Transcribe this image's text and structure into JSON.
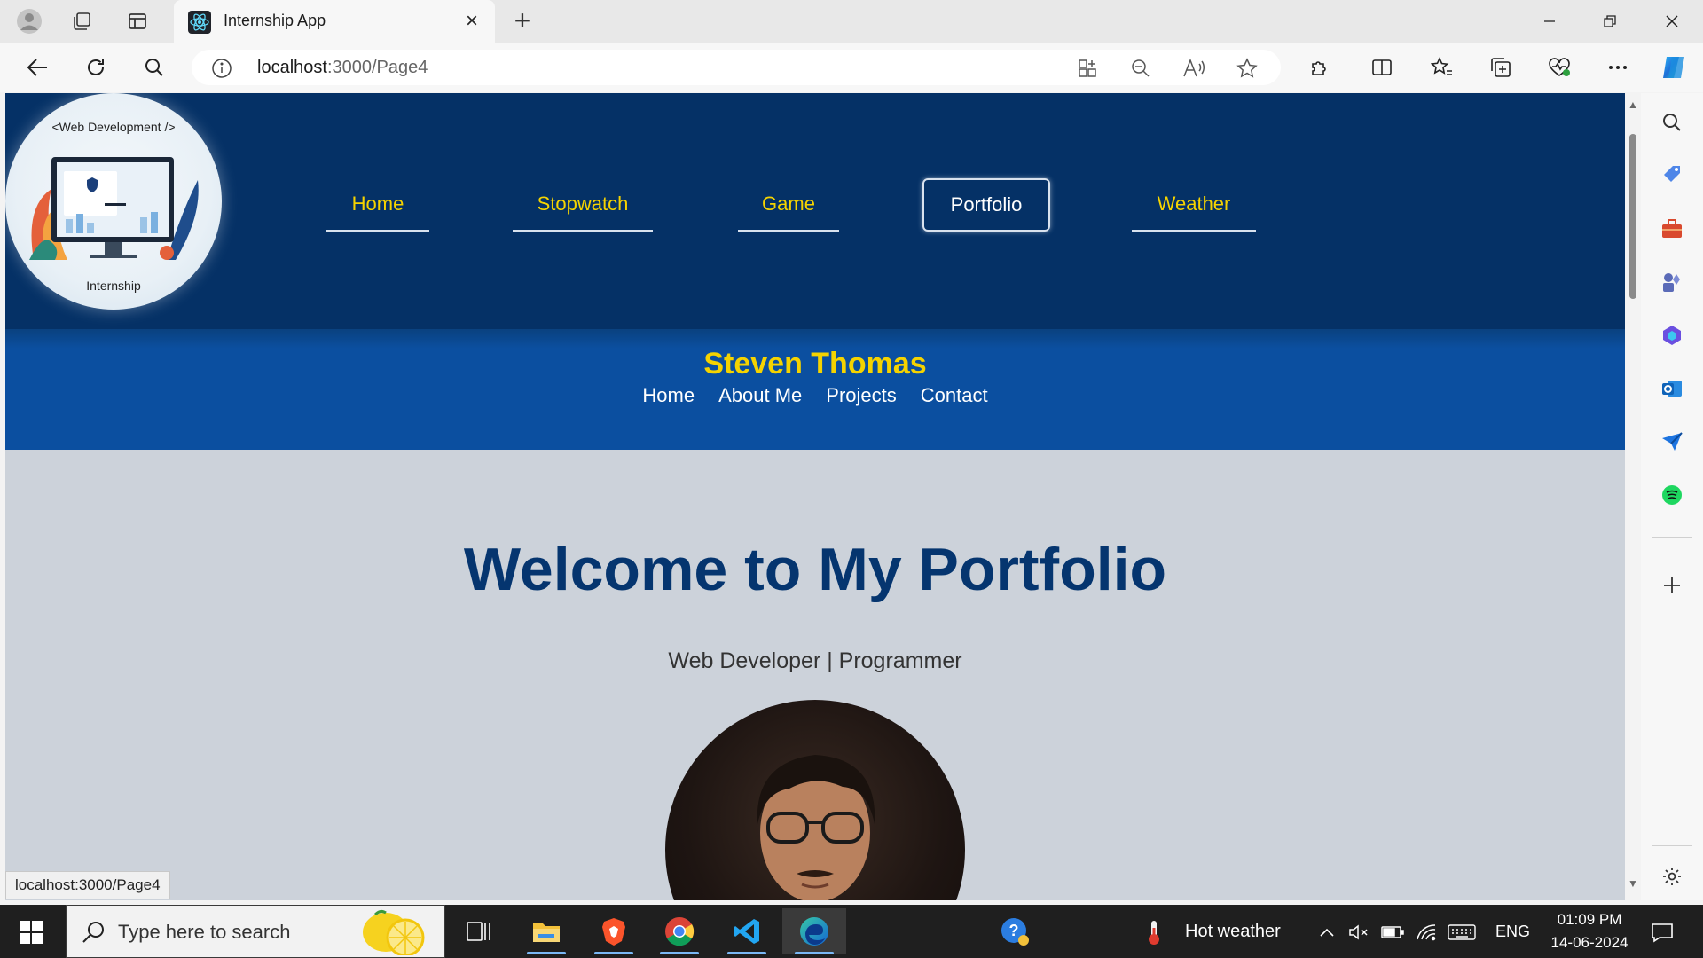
{
  "browser": {
    "tab_title": "Internship App",
    "url_host": "localhost",
    "url_path": ":3000/Page4",
    "status_url": "localhost:3000/Page4"
  },
  "site": {
    "logo_top": "<Web Development />",
    "logo_bottom": "Internship",
    "nav": [
      {
        "label": "Home",
        "active": false
      },
      {
        "label": "Stopwatch",
        "active": false
      },
      {
        "label": "Game",
        "active": false
      },
      {
        "label": "Portfolio",
        "active": true
      },
      {
        "label": "Weather",
        "active": false
      }
    ],
    "portfolio_name": "Steven Thomas",
    "sub_nav": [
      "Home",
      "About Me",
      "Projects",
      "Contact"
    ],
    "welcome": "Welcome to My Portfolio",
    "tagline": "Web Developer | Programmer",
    "colors": {
      "header_bg": "#053166",
      "subheader_bg": "#0b4fa0",
      "accent_yellow": "#f5d300",
      "content_bg": "#ccd2da",
      "heading": "#05356f"
    }
  },
  "taskbar": {
    "search_placeholder": "Type here to search",
    "weather": "Hot weather",
    "language": "ENG",
    "time": "01:09 PM",
    "date": "14-06-2024"
  },
  "icons": [
    "profile-icon",
    "workspaces-icon",
    "tab-actions-icon",
    "react-favicon",
    "back-icon",
    "refresh-icon",
    "search-icon",
    "info-icon",
    "app-available-icon",
    "zoom-out-icon",
    "read-aloud-icon",
    "favorite-star-icon",
    "extensions-icon",
    "split-screen-icon",
    "favorites-icon",
    "collections-icon",
    "browser-essentials-icon",
    "more-icon",
    "copilot-icon",
    "windows-start-icon"
  ]
}
